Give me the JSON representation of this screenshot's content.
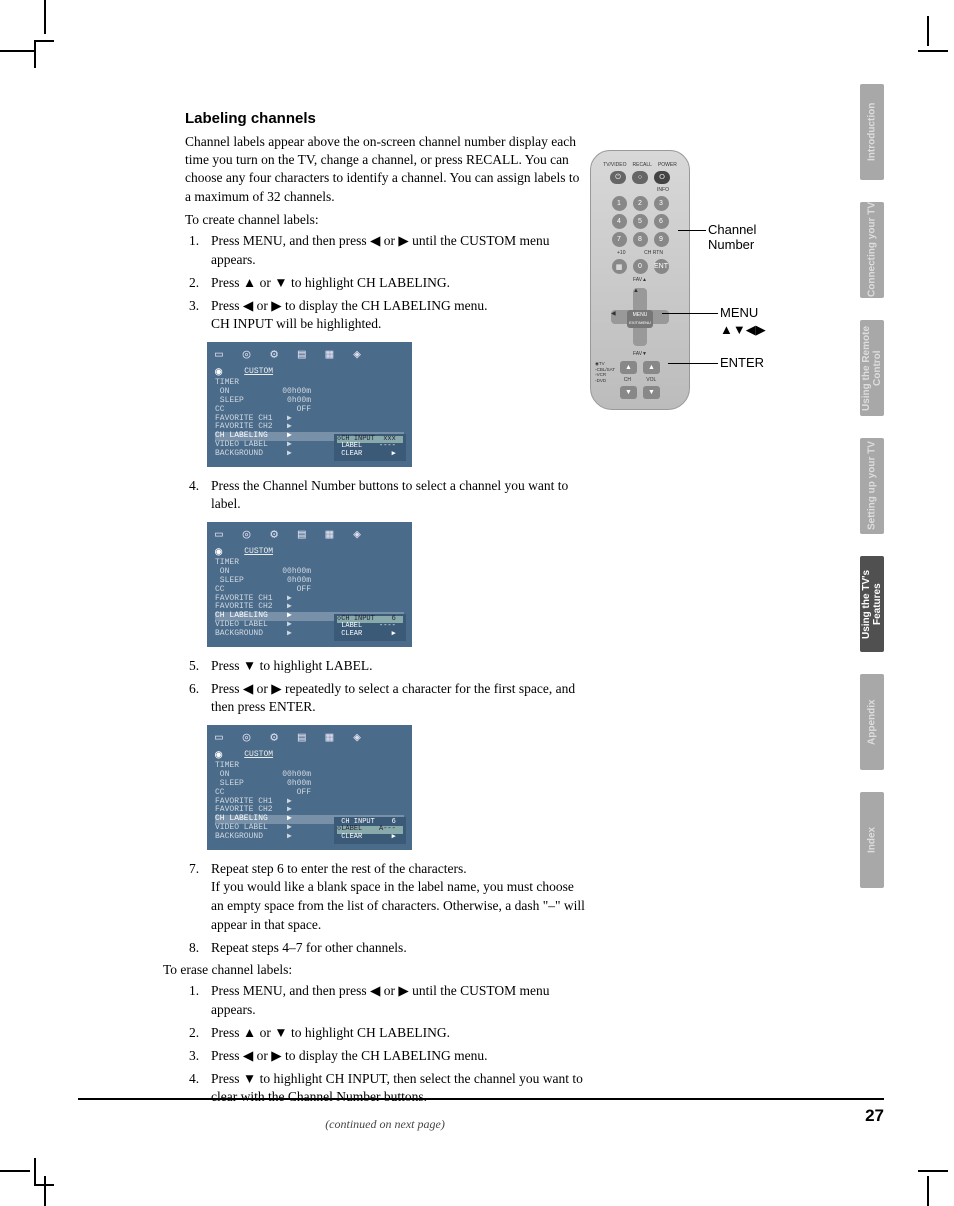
{
  "heading": "Labeling channels",
  "intro": "Channel labels appear above the on-screen channel number display each time you turn on the TV, change a channel, or press RECALL. You can choose any four characters to identify a channel. You can assign labels to a maximum of 32 channels.",
  "create_lead": "To create channel labels:",
  "steps_create": [
    "Press MENU, and then press ◀ or ▶ until the CUSTOM menu appears.",
    "Press ▲ or ▼ to highlight CH LABELING.",
    "Press ◀ or ▶ to display the CH LABELING menu.",
    "Press the Channel Number buttons to select a channel you want to label.",
    "Press ▼ to highlight LABEL.",
    "Press ◀ or ▶ repeatedly to select a character for the first space, and then press ENTER.",
    "Repeat step 6 to enter the rest of the characters.",
    "Repeat steps 4–7 for other channels."
  ],
  "step3_sub": "CH INPUT will be highlighted.",
  "step7_sub": "If you would like a blank space in the label name, you must choose an empty space from the list of characters. Otherwise, a dash \"–\" will appear in that space.",
  "erase_lead": "To erase channel labels:",
  "steps_erase": [
    "Press MENU, and then press ◀ or ▶ until the CUSTOM menu appears.",
    "Press ▲ or ▼ to highlight CH LABELING.",
    "Press ◀ or ▶ to display the CH LABELING menu.",
    "Press ▼ to highlight CH INPUT, then select the channel you want to clear with the Channel Number buttons."
  ],
  "continued": "(continued on next page)",
  "menu": {
    "title": "CUSTOM",
    "rows": [
      "TIMER",
      "ON",
      "SLEEP",
      "CC",
      "FAVORITE CH1",
      "FAVORITE CH2",
      "CH LABELING",
      "VIDEO LABEL",
      "BACKGROUND"
    ],
    "vals": [
      "",
      "00h00m",
      "0h00m",
      "OFF",
      "▶",
      "▶",
      "▶",
      "▶",
      "▶"
    ],
    "sub1": {
      "ch_input": "CH INPUT",
      "ch_val": "xxx",
      "label": "LABEL",
      "label_val": "----",
      "clear": "CLEAR"
    },
    "sub2": {
      "ch_val": "6",
      "label_val": "----"
    },
    "sub3": {
      "ch_val": "6",
      "label_val": "A---"
    }
  },
  "remote": {
    "toplabels": [
      "TV/VIDEO",
      "RECALL",
      "POWER"
    ],
    "info": "INFO",
    "nums": [
      "1",
      "2",
      "3",
      "4",
      "5",
      "6",
      "7",
      "8",
      "9",
      "0"
    ],
    "plus10": "+10",
    "chrtn": "CH RTN",
    "ent": "ENT",
    "fav_up": "FAV▲",
    "fav_dn": "FAV▼",
    "menu": "MENU",
    "exit": "EXIT/MENU",
    "bottom": [
      "TV",
      "CBL/SAT",
      "VCR",
      "DVD",
      "CH",
      "VOL"
    ]
  },
  "callouts": {
    "ch_num": "Channel Number",
    "menu": "MENU",
    "arrows": "▲▼◀▶",
    "enter": "ENTER"
  },
  "tabs": [
    "Introduction",
    "Connecting your TV",
    "Using the Remote Control",
    "Setting up your TV",
    "Using the TV's Features",
    "Appendix",
    "Index"
  ],
  "active_tab": 4,
  "page_number": "27"
}
